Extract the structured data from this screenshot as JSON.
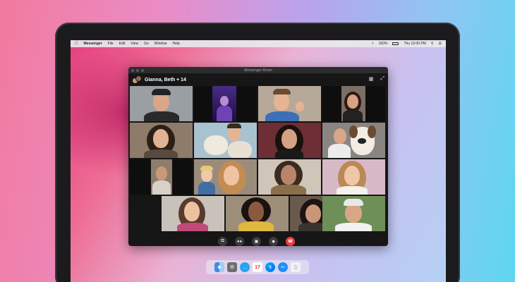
{
  "menubar": {
    "app_name": "Messenger",
    "items": [
      "File",
      "Edit",
      "View",
      "Go",
      "Window",
      "Help"
    ],
    "battery": "100%",
    "clock": "Thu 12:00 PM"
  },
  "window": {
    "title": "Messenger Room",
    "call_name": "Gianna, Beth + 14"
  },
  "icons": {
    "grid_view": "grid-view-icon",
    "fullscreen": "fullscreen-icon",
    "controls": [
      "screen-share-icon",
      "participants-icon",
      "camera-icon",
      "microphone-icon",
      "end-call-icon"
    ],
    "dock": [
      "finder-icon",
      "launchpad-icon",
      "messages-icon",
      "calendar-icon",
      "messenger-icon",
      "safari-icon",
      "trash-icon"
    ]
  },
  "dock": {
    "calendar_day": "17"
  },
  "colors": {
    "end_call": "#ef3b3b",
    "window_bg": "#161616",
    "messenger_blue": "#0a7cff"
  }
}
